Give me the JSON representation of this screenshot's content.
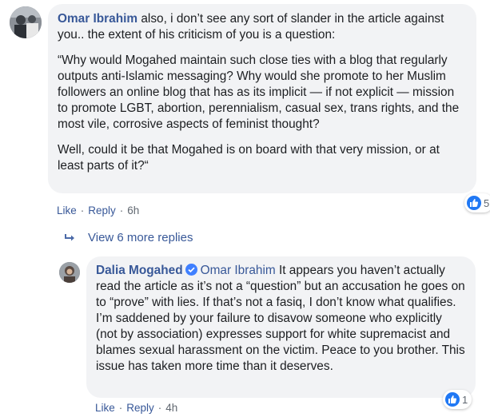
{
  "comment1": {
    "author": "Omar Ibrahim",
    "intro": " also, i don’t see any sort of slander in the article against you.. the extent of his criticism of you is a question:",
    "quote": "“Why would Mogahed maintain such close ties with a blog that regularly outputs anti-Islamic messaging? Why would she promote to her Muslim followers an online blog that has as its implicit — if not explicit — mission to promote LGBT, abortion, perennialism, casual sex, trans rights, and the most vile, corrosive aspects of feminist thought?",
    "closing": "Well, could it be that Mogahed is on board with that very mission, or at least parts of it?“",
    "reaction_count": "5",
    "actions": {
      "like": "Like",
      "reply": "Reply",
      "time": "6h"
    }
  },
  "view_more": {
    "label": "View 6 more replies"
  },
  "comment2": {
    "author": "Dalia Mogahed",
    "mention": "Omar Ibrahim",
    "text": " It appears you haven’t actually read the article as it’s not a “question” but an accusation he goes on to “prove” with lies. If that’s not a fasiq, I don’t know what qualifies. I’m saddened by your failure to disavow someone who explicitly (not by association) expresses support for white supremacist and blames sexual harassment on the victim. Peace to you brother. This issue has taken more time than it deserves.",
    "reaction_count": "1",
    "actions": {
      "like": "Like",
      "reply": "Reply",
      "time": "4h"
    }
  },
  "colors": {
    "link": "#385898",
    "bubble": "#f2f3f5",
    "like_blue": "#2078f4",
    "verified": "#4080ff"
  },
  "icons": [
    "avatar",
    "like-icon",
    "verified-badge-icon",
    "reply-arrow-icon"
  ]
}
